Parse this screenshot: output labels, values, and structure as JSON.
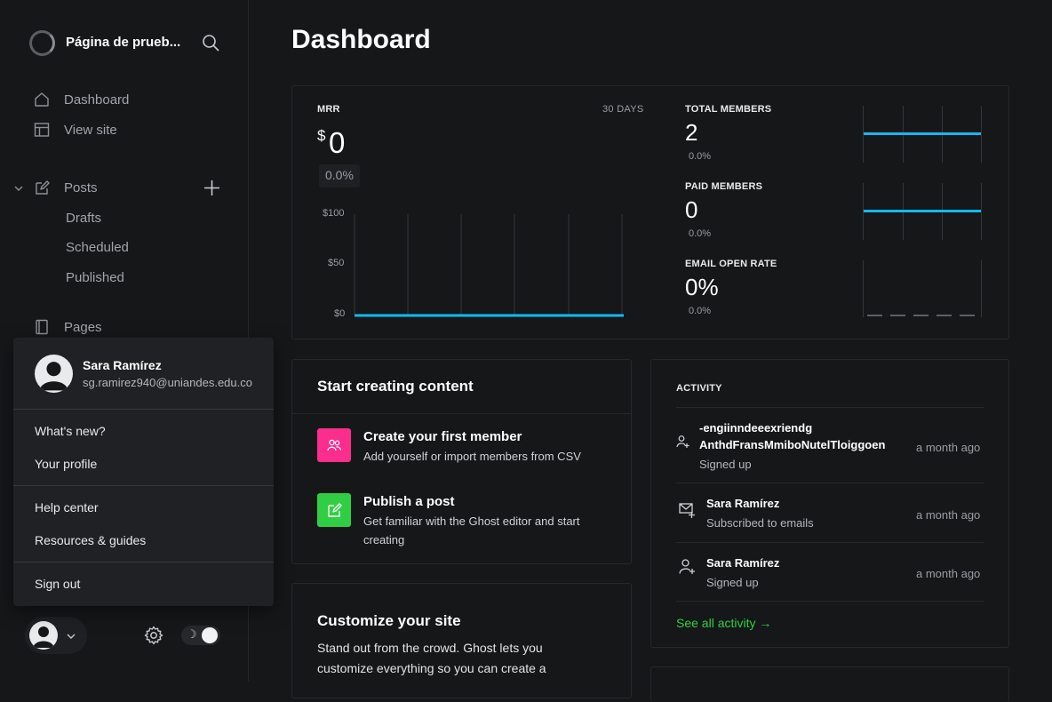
{
  "sidebar": {
    "site_title": "Página de prueb...",
    "nav": {
      "dashboard": "Dashboard",
      "view_site": "View site",
      "posts": "Posts",
      "drafts": "Drafts",
      "scheduled": "Scheduled",
      "published": "Published",
      "pages": "Pages"
    }
  },
  "user_menu": {
    "name": "Sara Ramírez",
    "email": "sg.ramirez940@uniandes.edu.co",
    "items": {
      "whats_new": "What's new?",
      "your_profile": "Your profile",
      "help_center": "Help center",
      "resources": "Resources & guides",
      "sign_out": "Sign out"
    }
  },
  "page": {
    "title": "Dashboard"
  },
  "mrr": {
    "label": "MRR",
    "period": "30 DAYS",
    "currency": "$",
    "value": "0",
    "change": "0.0%",
    "y_ticks": [
      "$100",
      "$50",
      "$0"
    ]
  },
  "chart_data": {
    "type": "line",
    "title": "MRR",
    "series": [
      {
        "values": [
          0,
          0,
          0,
          0,
          0,
          0,
          0,
          0,
          0,
          0,
          0,
          0,
          0,
          0,
          0,
          0,
          0,
          0,
          0,
          0,
          0,
          0,
          0,
          0,
          0,
          0,
          0,
          0,
          0,
          0
        ]
      }
    ],
    "ylim": [
      0,
      100
    ],
    "grid": true,
    "color": "#14b8f5"
  },
  "metrics": [
    {
      "label": "TOTAL MEMBERS",
      "value": "2",
      "change": "0.0%"
    },
    {
      "label": "PAID MEMBERS",
      "value": "0",
      "change": "0.0%"
    },
    {
      "label": "EMAIL OPEN RATE",
      "value": "0%",
      "change": "0.0%"
    }
  ],
  "start_creating": {
    "title": "Start creating content",
    "items": [
      {
        "title": "Create your first member",
        "desc": "Add yourself or import members from CSV",
        "color": "#fb2d8d",
        "icon": "members-icon"
      },
      {
        "title": "Publish a post",
        "desc": "Get familiar with the Ghost editor and start creating",
        "color": "#30cf43",
        "icon": "edit-icon"
      }
    ]
  },
  "customize": {
    "title": "Customize your site",
    "desc": "Stand out from the crowd. Ghost lets you customize everything so you can create a"
  },
  "activity": {
    "title": "ACTIVITY",
    "items": [
      {
        "name": "-engiinndeeexriendg AnthdFransMmiboNutelTloiggoen",
        "action": "Signed up",
        "time": "a month ago",
        "icon": "user-add-icon"
      },
      {
        "name": "Sara Ramírez",
        "action": "Subscribed to emails",
        "time": "a month ago",
        "icon": "mail-plus-icon"
      },
      {
        "name": "Sara Ramírez",
        "action": "Signed up",
        "time": "a month ago",
        "icon": "user-add-icon"
      }
    ],
    "see_all": "See all activity →"
  },
  "colors": {
    "accent": "#14b8f5",
    "brand_green": "#30cf43",
    "pink": "#fb2d8d"
  }
}
